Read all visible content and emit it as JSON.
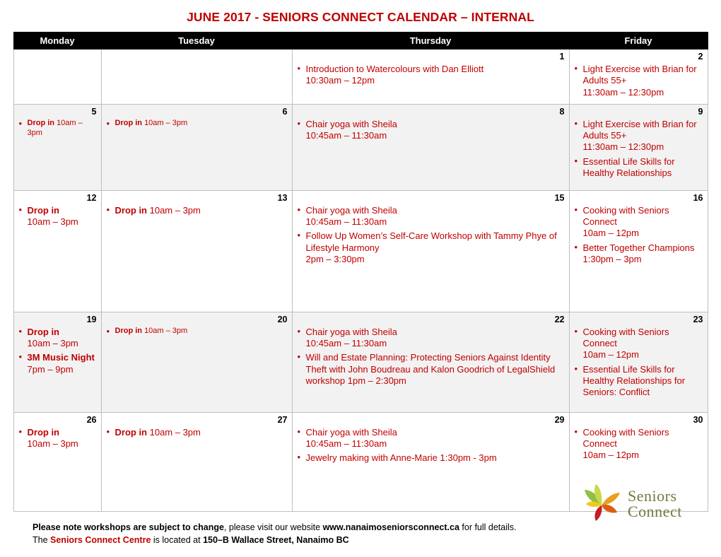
{
  "title": "JUNE 2017 - SENIORS CONNECT CALENDAR – INTERNAL",
  "columns": [
    {
      "label": "Monday"
    },
    {
      "label": "Tuesday"
    },
    {
      "label": "Thursday"
    },
    {
      "label": "Friday"
    }
  ],
  "weeks": [
    {
      "shaded": false,
      "days": [
        {
          "num": "",
          "items": []
        },
        {
          "num": "",
          "items": []
        },
        {
          "num": "1",
          "items": [
            {
              "lines": [
                {
                  "text": "Introduction to Watercolours with Dan Elliott",
                  "bold": false
                },
                {
                  "text": "10:30am – 12pm",
                  "bold": false
                }
              ]
            }
          ]
        },
        {
          "num": "2",
          "items": [
            {
              "lines": [
                {
                  "text": "Light Exercise with Brian for Adults 55+",
                  "bold": false
                },
                {
                  "text": "11:30am – 12:30pm",
                  "bold": false
                }
              ]
            }
          ]
        }
      ]
    },
    {
      "shaded": true,
      "days": [
        {
          "num": "5",
          "items": [
            {
              "lines": [
                {
                  "text": "Drop in ",
                  "bold": true
                },
                {
                  "text": "10am – 3pm",
                  "bold": false
                }
              ],
              "inline": true
            }
          ]
        },
        {
          "num": "6",
          "items": [
            {
              "lines": [
                {
                  "text": "Drop in ",
                  "bold": true
                },
                {
                  "text": "10am – 3pm",
                  "bold": false
                }
              ],
              "inline": true
            }
          ]
        },
        {
          "num": "8",
          "items": [
            {
              "lines": [
                {
                  "text": "Chair yoga with Sheila",
                  "bold": false
                },
                {
                  "text": "10:45am – 11:30am",
                  "bold": false
                }
              ]
            }
          ]
        },
        {
          "num": "9",
          "items": [
            {
              "lines": [
                {
                  "text": "Light Exercise with Brian for Adults 55+",
                  "bold": false
                },
                {
                  "text": "11:30am – 12:30pm",
                  "bold": false
                }
              ]
            },
            {
              "lines": [
                {
                  "text": "Essential Life Skills for Healthy Relationships",
                  "bold": false
                }
              ]
            }
          ]
        }
      ]
    },
    {
      "shaded": false,
      "days": [
        {
          "num": "12",
          "items": [
            {
              "lines": [
                {
                  "text": "Drop in",
                  "bold": true
                },
                {
                  "text": "10am – 3pm",
                  "bold": false
                }
              ]
            }
          ]
        },
        {
          "num": "13",
          "items": [
            {
              "lines": [
                {
                  "text": "Drop in ",
                  "bold": true
                },
                {
                  "text": "10am – 3pm",
                  "bold": false
                }
              ],
              "inline": true
            }
          ]
        },
        {
          "num": "15",
          "items": [
            {
              "lines": [
                {
                  "text": "Chair yoga with Sheila",
                  "bold": false
                },
                {
                  "text": "10:45am – 11:30am",
                  "bold": false
                }
              ]
            },
            {
              "lines": [
                {
                  "text": "Follow Up Women’s Self-Care Workshop with Tammy Phye of Lifestyle Harmony",
                  "bold": false
                },
                {
                  "text": "2pm – 3:30pm",
                  "bold": false
                }
              ]
            }
          ]
        },
        {
          "num": "16",
          "items": [
            {
              "lines": [
                {
                  "text": "Cooking with Seniors Connect",
                  "bold": false
                },
                {
                  "text": "10am – 12pm",
                  "bold": false
                }
              ]
            },
            {
              "lines": [
                {
                  "text": "Better Together Champions",
                  "bold": false
                },
                {
                  "text": "1:30pm – 3pm",
                  "bold": false
                }
              ]
            }
          ]
        }
      ]
    },
    {
      "shaded": true,
      "days": [
        {
          "num": "19",
          "items": [
            {
              "lines": [
                {
                  "text": "Drop in",
                  "bold": true
                },
                {
                  "text": "10am – 3pm",
                  "bold": false
                }
              ]
            },
            {
              "lines": [
                {
                  "text": "3M Music Night",
                  "bold": true
                },
                {
                  "text": "7pm – 9pm",
                  "bold": false
                }
              ]
            }
          ]
        },
        {
          "num": "20",
          "items": [
            {
              "lines": [
                {
                  "text": "Drop in ",
                  "bold": true
                },
                {
                  "text": "10am – 3pm",
                  "bold": false
                }
              ],
              "inline": true
            }
          ]
        },
        {
          "num": "22",
          "items": [
            {
              "lines": [
                {
                  "text": "Chair yoga with Sheila",
                  "bold": false
                },
                {
                  "text": "10:45am – 11:30am",
                  "bold": false
                }
              ]
            },
            {
              "lines": [
                {
                  "text": "Will and Estate Planning: Protecting   Seniors Against Identity Theft with John Boudreau and Kalon Goodrich of LegalShield workshop 1pm – 2:30pm",
                  "bold": false
                }
              ]
            }
          ]
        },
        {
          "num": "23",
          "items": [
            {
              "lines": [
                {
                  "text": "Cooking with Seniors Connect",
                  "bold": false
                },
                {
                  "text": "10am – 12pm",
                  "bold": false
                }
              ]
            },
            {
              "lines": [
                {
                  "text": "Essential Life Skills for Healthy Relationships for Seniors: Conflict",
                  "bold": false
                }
              ]
            }
          ]
        }
      ]
    },
    {
      "shaded": false,
      "days": [
        {
          "num": "26",
          "items": [
            {
              "lines": [
                {
                  "text": "Drop in",
                  "bold": true
                },
                {
                  "text": "10am – 3pm",
                  "bold": false
                }
              ]
            }
          ]
        },
        {
          "num": "27",
          "items": [
            {
              "lines": [
                {
                  "text": "Drop in ",
                  "bold": true
                },
                {
                  "text": "10am – 3pm",
                  "bold": false
                }
              ],
              "inline": true
            }
          ]
        },
        {
          "num": "29",
          "items": [
            {
              "lines": [
                {
                  "text": "Chair yoga with Sheila",
                  "bold": false
                },
                {
                  "text": "10:45am – 11:30am",
                  "bold": false
                }
              ]
            },
            {
              "lines": [
                {
                  "text": "Jewelry making with Anne-Marie 1:30pm - 3pm",
                  "bold": false
                }
              ]
            }
          ]
        },
        {
          "num": "30",
          "items": [
            {
              "lines": [
                {
                  "text": "Cooking with Seniors Connect",
                  "bold": false
                },
                {
                  "text": "10am – 12pm",
                  "bold": false
                }
              ]
            }
          ]
        }
      ]
    }
  ],
  "footer": {
    "line1_bold": "Please note workshops are subject to change",
    "line1_mid": ", please visit our website ",
    "line1_site": "www.nanaimoseniorsconnect.ca",
    "line1_end": " for full details.",
    "line2_a": "The ",
    "line2_red": "Seniors Connect Centre",
    "line2_b": " is located at ",
    "line2_addr": "150–B Wallace Street, Nanaimo BC"
  },
  "logo": {
    "line1": "Seniors",
    "line2": "Connect"
  },
  "colors": {
    "accent_red": "#c00000",
    "header_bg": "#000000",
    "shade": "#f2f2f2",
    "logo_green": "#6f7b3e"
  }
}
